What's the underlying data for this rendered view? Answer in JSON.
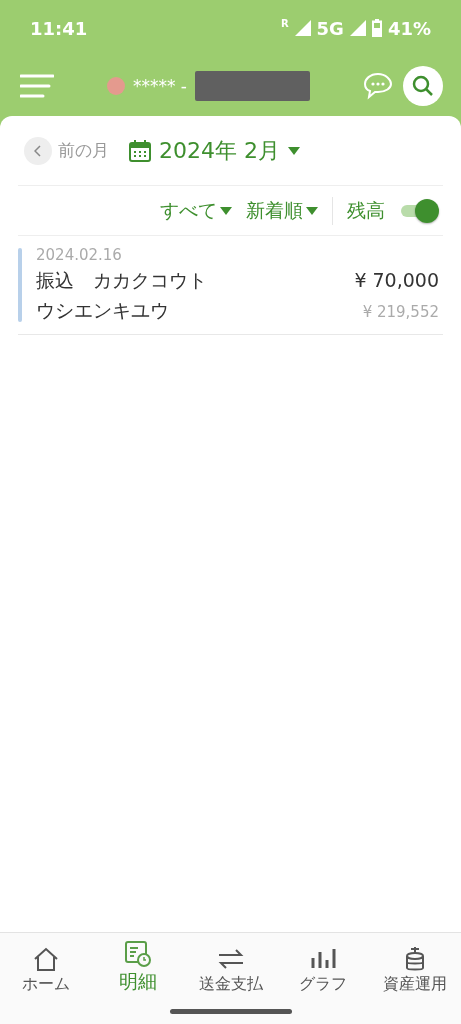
{
  "status_bar": {
    "time": "11:41",
    "roaming": "R",
    "network": "5G",
    "battery": "41%"
  },
  "header": {
    "account": "***** -"
  },
  "month_nav": {
    "prev": "前の月",
    "month": "2024年 2月"
  },
  "filters": {
    "category": "すべて",
    "sort": "新着順",
    "balance_label": "残高",
    "balance_on": true
  },
  "transactions": [
    {
      "date": "2024.02.16",
      "title": "振込　カカクコウト",
      "subtitle": "ウシエンキユウ",
      "amount": "¥ 70,000",
      "balance": "¥ 219,552"
    }
  ],
  "tabs": [
    {
      "kind": "home",
      "label": "ホーム",
      "selected": false
    },
    {
      "kind": "statement",
      "label": "明細",
      "selected": true
    },
    {
      "kind": "transfer",
      "label": "送金支払",
      "selected": false
    },
    {
      "kind": "graph",
      "label": "グラフ",
      "selected": false
    },
    {
      "kind": "invest",
      "label": "資産運用",
      "selected": false
    }
  ]
}
